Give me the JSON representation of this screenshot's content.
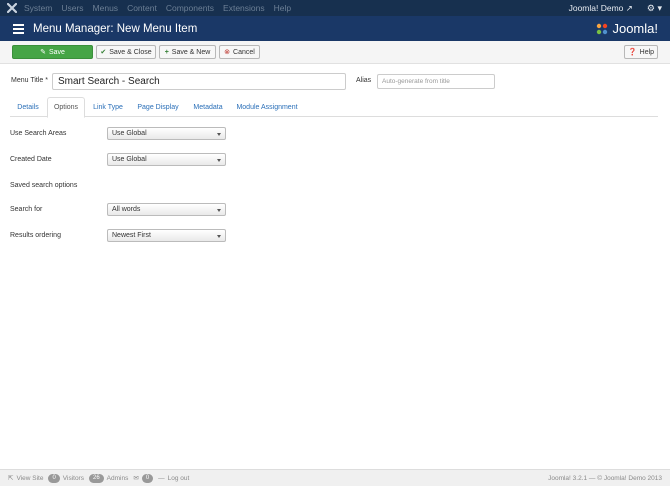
{
  "navbar": {
    "logo_icon": "joomla-x-icon",
    "items": [
      "System",
      "Users",
      "Menus",
      "Content",
      "Components",
      "Extensions",
      "Help"
    ],
    "site_link": "Joomla! Demo",
    "settings_icon": "gear-icon"
  },
  "header": {
    "title": "Menu Manager: New Menu Item",
    "brand": "Joomla!"
  },
  "toolbar": {
    "save": "Save",
    "save_close": "Save & Close",
    "save_new": "Save & New",
    "cancel": "Cancel",
    "help": "Help"
  },
  "form": {
    "title_label": "Menu Title *",
    "title_value": "Smart Search - Search",
    "alias_label": "Alias",
    "alias_placeholder": "Auto-generate from title"
  },
  "tabs": [
    "Details",
    "Options",
    "Link Type",
    "Page Display",
    "Metadata",
    "Module Assignment"
  ],
  "active_tab": "Options",
  "options": {
    "search_areas_label": "Use Search Areas",
    "search_areas_value": "Use Global",
    "created_date_label": "Created Date",
    "created_date_value": "Use Global",
    "saved_search_label": "Saved search options",
    "search_for_label": "Search for",
    "search_for_value": "All words",
    "results_ordering_label": "Results ordering",
    "results_ordering_value": "Newest First"
  },
  "footer": {
    "view_site": "View Site",
    "visitors_count": "0",
    "visitors_label": "Visitors",
    "admins_count": "26",
    "admins_label": "Admins",
    "messages_count": "0",
    "logout": "Log out",
    "copyright": "Joomla! 3.2.1 — © Joomla! Demo 2013"
  },
  "colors": {
    "navbar": "#17304f",
    "header": "#1a3867",
    "save_button": "#46a546",
    "link": "#2a6fb8"
  }
}
